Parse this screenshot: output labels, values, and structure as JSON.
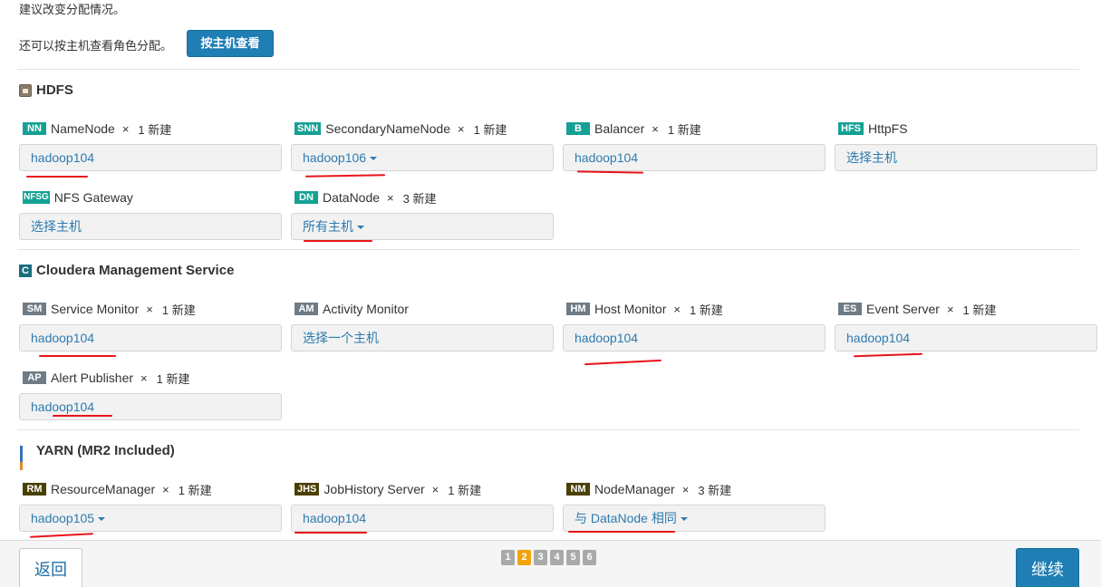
{
  "intro": {
    "line1": "建议改变分配情况。",
    "line2": "还可以按主机查看角色分配。",
    "view_by_host_button": "按主机查看"
  },
  "hdfs": {
    "title": "HDFS",
    "roles": [
      {
        "badge": "NN",
        "name": "NameNode",
        "x": "×",
        "new": "1 新建",
        "host": "hadoop104"
      },
      {
        "badge": "SNN",
        "name": "SecondaryNameNode",
        "x": "×",
        "new": "1 新建",
        "host": "hadoop106"
      },
      {
        "badge": "B",
        "name": "Balancer",
        "x": "×",
        "new": "1 新建",
        "host": "hadoop104"
      },
      {
        "badge": "HFS",
        "name": "HttpFS",
        "host": "选择主机"
      },
      {
        "badge": "NFSG",
        "name": "NFS Gateway",
        "host": "选择主机"
      },
      {
        "badge": "DN",
        "name": "DataNode",
        "x": "×",
        "new": "3 新建",
        "host": "所有主机"
      }
    ]
  },
  "cms": {
    "title": "Cloudera Management Service",
    "icon_letter": "C",
    "roles": [
      {
        "badge": "SM",
        "name": "Service Monitor",
        "x": "×",
        "new": "1 新建",
        "host": "hadoop104"
      },
      {
        "badge": "AM",
        "name": "Activity Monitor",
        "host": "选择一个主机"
      },
      {
        "badge": "HM",
        "name": "Host Monitor",
        "x": "×",
        "new": "1 新建",
        "host": "hadoop104"
      },
      {
        "badge": "ES",
        "name": "Event Server",
        "x": "×",
        "new": "1 新建",
        "host": "hadoop104"
      },
      {
        "badge": "AP",
        "name": "Alert Publisher",
        "x": "×",
        "new": "1 新建",
        "host": "hadoop104"
      }
    ]
  },
  "yarn": {
    "title": "YARN (MR2 Included)",
    "roles": [
      {
        "badge": "RM",
        "name": "ResourceManager",
        "x": "×",
        "new": "1 新建",
        "host": "hadoop105"
      },
      {
        "badge": "JHS",
        "name": "JobHistory Server",
        "x": "×",
        "new": "1 新建",
        "host": "hadoop104"
      },
      {
        "badge": "NM",
        "name": "NodeManager",
        "x": "×",
        "new": "3 新建",
        "host": "与 DataNode 相同"
      }
    ]
  },
  "footer": {
    "back": "返回",
    "continue": "继续",
    "pages": [
      "1",
      "2",
      "3",
      "4",
      "5",
      "6"
    ],
    "current_page": "2"
  },
  "colors": {
    "primary": "#1f7eb4",
    "teal_badge": "#14a194",
    "gray_badge": "#6f7c85",
    "olive_badge": "#4a3f05",
    "link": "#2e7bb0",
    "annotation_red": "#e8141a",
    "page_active": "#f0a30a"
  }
}
